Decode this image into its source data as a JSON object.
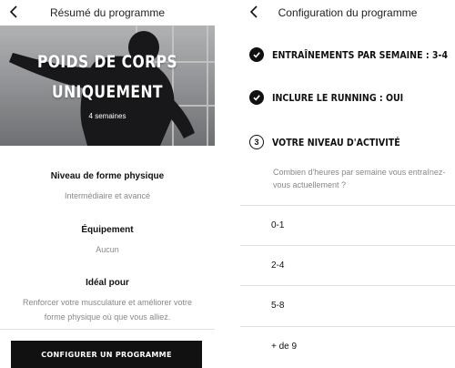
{
  "left_screen": {
    "title": "Résumé du programme",
    "hero": {
      "title": "POIDS DE CORPS\nUNIQUEMENT",
      "subtitle": "4 semaines"
    },
    "details": [
      {
        "heading": "Niveau de forme physique",
        "value": "Intermédiaire et avancé"
      },
      {
        "heading": "Équipement",
        "value": "Aucun"
      },
      {
        "heading": "Idéal pour",
        "value": "Renforcer votre musculature et améliorer votre forme physique où que vous alliez."
      }
    ],
    "cta_label": "CONFIGURER UN PROGRAMME"
  },
  "right_screen": {
    "title": "Configuration du programme",
    "steps": [
      {
        "label": "ENTRAÎNEMENTS PAR SEMAINE : 3-4",
        "state": "done"
      },
      {
        "label": "INCLURE LE RUNNING : OUI",
        "state": "done"
      },
      {
        "label": "VOTRE NIVEAU D'ACTIVITÉ",
        "state": "current",
        "number": "3"
      }
    ],
    "question": "Combien d'heures par semaine vous entraînez-vous actuellement ?",
    "options": [
      "0-1",
      "2-4",
      "5-8",
      "+ de 9"
    ]
  },
  "colors": {
    "text": "#111111",
    "muted": "#888888",
    "button_bg": "#111111",
    "divider": "#e2e2e2"
  },
  "icons": {
    "back": "chevron-left-icon",
    "check": "check-icon"
  }
}
